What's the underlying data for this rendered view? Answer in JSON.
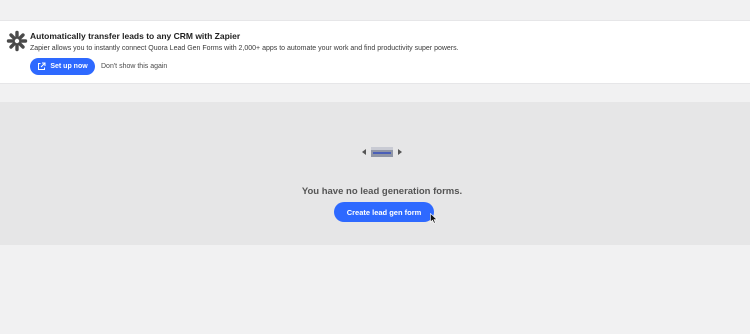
{
  "banner": {
    "title": "Automatically transfer leads to any CRM with Zapier",
    "description": "Zapier allows you to instantly connect Quora Lead Gen Forms with 2,000+ apps to automate your work and find productivity super powers.",
    "setup_label": "Set up now",
    "dismiss_label": "Don't show this again",
    "icon": "zapier-asterisk-icon",
    "accent": "#2e69ff"
  },
  "empty_state": {
    "message": "You have no lead generation forms.",
    "create_label": "Create lead gen form"
  }
}
